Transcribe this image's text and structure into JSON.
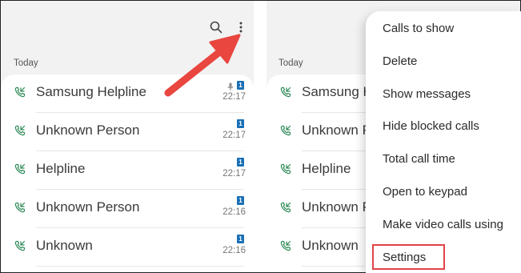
{
  "left_panel": {
    "section_label": "Today",
    "calls": [
      {
        "name": "Samsung Helpline",
        "time": "22:17",
        "sim": "1",
        "voicemail": true
      },
      {
        "name": "Unknown Person",
        "time": "22:17",
        "sim": "1",
        "voicemail": false
      },
      {
        "name": "Helpline",
        "time": "22:17",
        "sim": "1",
        "voicemail": false
      },
      {
        "name": "Unknown Person",
        "time": "22:16",
        "sim": "1",
        "voicemail": false
      },
      {
        "name": "Unknown",
        "time": "22:16",
        "sim": "1",
        "voicemail": false
      }
    ]
  },
  "right_panel": {
    "section_label": "Today",
    "calls": [
      {
        "name": "Samsung Helpline"
      },
      {
        "name": "Unknown Person"
      },
      {
        "name": "Helpline"
      },
      {
        "name": "Unknown Person"
      },
      {
        "name": "Unknown"
      }
    ]
  },
  "menu": {
    "items": [
      {
        "label": "Calls to show"
      },
      {
        "label": "Delete"
      },
      {
        "label": "Show messages"
      },
      {
        "label": "Hide blocked calls"
      },
      {
        "label": "Total call time"
      },
      {
        "label": "Open to keypad"
      },
      {
        "label": "Make video calls using"
      },
      {
        "label": "Settings",
        "highlighted": true
      }
    ]
  },
  "icons": {
    "search": "search-icon",
    "more": "more-options-icon",
    "call_type": "incoming-call-icon",
    "sim": "sim-1-icon",
    "voicemail": "microphone-icon"
  },
  "colors": {
    "panel_bg": "#f2f2f2",
    "sim_badge": "#1a6fb6",
    "call_icon": "#2e8b57",
    "highlight_box": "#e0434a",
    "arrow": "#e8463f"
  }
}
